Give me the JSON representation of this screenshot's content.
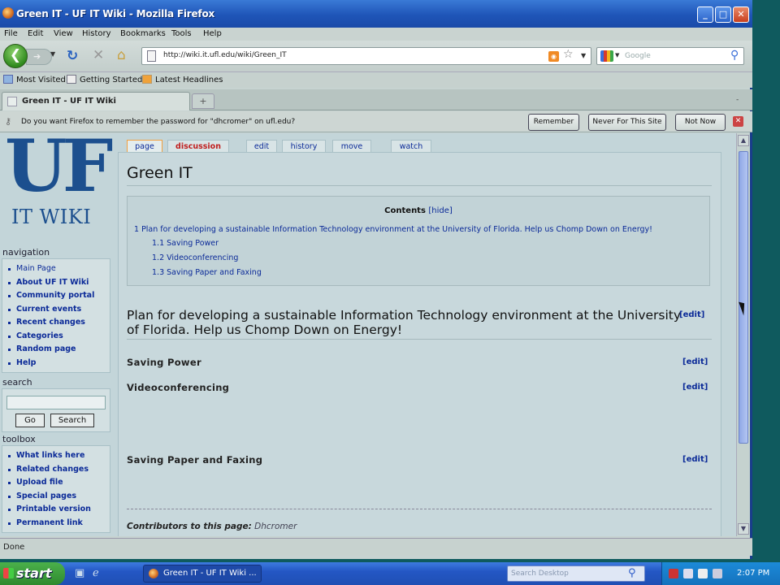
{
  "window": {
    "title": "Green IT - UF IT Wiki - Mozilla Firefox"
  },
  "menu": [
    "File",
    "Edit",
    "View",
    "History",
    "Bookmarks",
    "Tools",
    "Help"
  ],
  "nav": {
    "url": "http://wiki.it.ufl.edu/wiki/Green_IT",
    "search_placeholder": "Google"
  },
  "bookmarks": [
    "Most Visited",
    "Getting Started",
    "Latest Headlines"
  ],
  "tab": {
    "label": "Green IT - UF IT Wiki",
    "new_tab": "+",
    "list": "-"
  },
  "notify": {
    "message": "Do you want Firefox to remember the password for \"dhcromer\" on ufl.edu?",
    "remember": "Remember",
    "never": "Never For This Site",
    "not_now": "Not Now"
  },
  "sidebar": {
    "logo_uf": "UF",
    "logo_it": "IT WIKI",
    "navigation_heading": "navigation",
    "navigation": [
      "Main Page",
      "About UF IT Wiki",
      "Community portal",
      "Current events",
      "Recent changes",
      "Categories",
      "Random page",
      "Help"
    ],
    "search_heading": "search",
    "go": "Go",
    "search": "Search",
    "toolbox_heading": "toolbox",
    "toolbox": [
      "What links here",
      "Related changes",
      "Upload file",
      "Special pages",
      "Printable version",
      "Permanent link"
    ]
  },
  "page_tabs": [
    "page",
    "discussion",
    "edit",
    "history",
    "move",
    "watch"
  ],
  "article": {
    "title": "Green IT",
    "toc_heading": "Contents",
    "toc_hide": "[hide]",
    "toc": [
      "1 Plan for developing a sustainable Information Technology environment at the University of Florida.  Help us Chomp Down on Energy!",
      "1.1 Saving Power",
      "1.2 Videoconferencing",
      "1.3 Saving Paper and Faxing"
    ],
    "h2": "Plan for developing a sustainable Information Technology environment at the University of Florida.  Help us Chomp Down on Energy!",
    "edit": "[edit]",
    "sections": [
      "Saving Power",
      "Videoconferencing",
      "Saving Paper and Faxing"
    ],
    "contributors_label": "Contributors to this page:",
    "contributors": "Dhcromer"
  },
  "status": "Done",
  "taskbar": {
    "start": "start",
    "window_button": "Green IT - UF IT Wiki ...",
    "desktop_search_placeholder": "Search Desktop",
    "clock": "2:07 PM"
  }
}
